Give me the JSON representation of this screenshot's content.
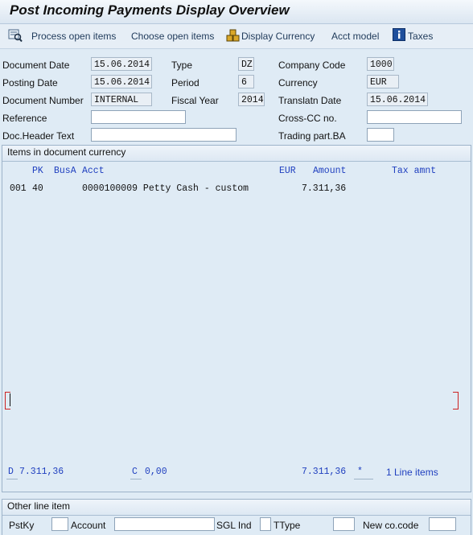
{
  "window": {
    "title": "Post Incoming Payments Display Overview"
  },
  "toolbar": {
    "process_open_items": "Process open items",
    "choose_open_items": "Choose open items",
    "display_currency": "Display Currency",
    "acct_model": "Acct model",
    "taxes": "Taxes"
  },
  "header": {
    "document_date": {
      "label": "Document Date",
      "value": "15.06.2014"
    },
    "posting_date": {
      "label": "Posting Date",
      "value": "15.06.2014"
    },
    "document_number": {
      "label": "Document Number",
      "value": "INTERNAL"
    },
    "reference": {
      "label": "Reference",
      "value": ""
    },
    "doc_header_text": {
      "label": "Doc.Header Text",
      "value": ""
    },
    "type": {
      "label": "Type",
      "value": "DZ"
    },
    "period": {
      "label": "Period",
      "value": "6"
    },
    "fiscal_year": {
      "label": "Fiscal Year",
      "value": "2014"
    },
    "company_code": {
      "label": "Company Code",
      "value": "1000"
    },
    "currency": {
      "label": "Currency",
      "value": "EUR"
    },
    "translatn_date": {
      "label": "Translatn Date",
      "value": "15.06.2014"
    },
    "cross_cc_no": {
      "label": "Cross-CC no.",
      "value": ""
    },
    "trading_part_ba": {
      "label": "Trading part.BA",
      "value": ""
    }
  },
  "items": {
    "title": "Items in document currency",
    "columns": {
      "pk": "PK",
      "busa": "BusA",
      "acct": "Acct",
      "cur": "EUR",
      "amount": "Amount",
      "tax": "Tax amnt"
    },
    "rows": [
      {
        "no": "001",
        "pk": "40",
        "busa": "",
        "acct": "0000100009 Petty Cash - custom",
        "amount": "7.311,36",
        "tax": ""
      }
    ],
    "totals": {
      "d_label": "D",
      "d_value": "7.311,36",
      "c_label": "C",
      "c_value": "0,00",
      "balance": "7.311,36",
      "star": "*",
      "line_items": "1 Line items"
    }
  },
  "other_line_item": {
    "title": "Other line item",
    "pstky": {
      "label": "PstKy",
      "value": ""
    },
    "account": {
      "label": "Account",
      "value": ""
    },
    "sgl_ind": {
      "label": "SGL Ind",
      "value": ""
    },
    "ttype": {
      "label": "TType",
      "value": ""
    },
    "new_co_code": {
      "label": "New co.code",
      "value": ""
    }
  }
}
